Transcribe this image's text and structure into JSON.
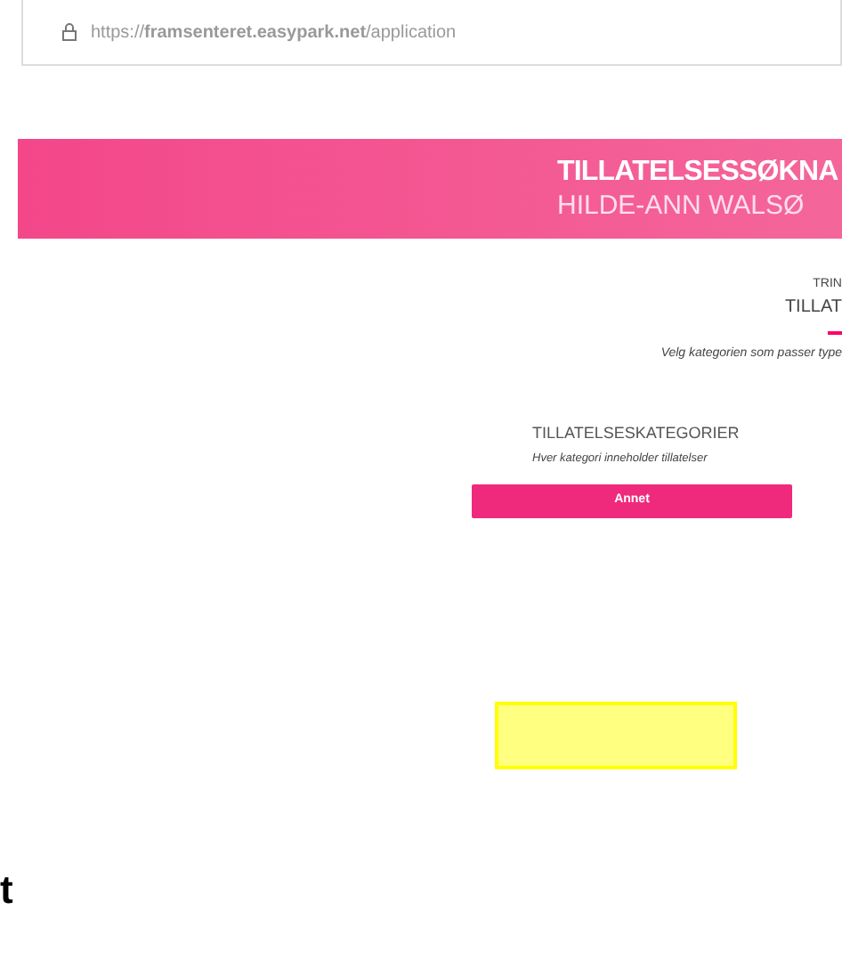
{
  "address_bar": {
    "url": "https://**framsenteret.easypark.net**/application"
  },
  "banner": {
    "title": "TILLATELSESSØKNA",
    "subtitle": "HILDE-ANN WALSØ"
  },
  "step": {
    "label": "TRIN",
    "name": "TILLAT",
    "instruction": "Velg kategorien som passer type"
  },
  "categories": {
    "heading": "TILLATELSESKATEGORIER",
    "hint": "Hver kategori inneholder tillatelser",
    "buttons": [
      {
        "label": "Annet"
      }
    ]
  },
  "highlight": {
    "kind": "box"
  },
  "stray_text": "t"
}
